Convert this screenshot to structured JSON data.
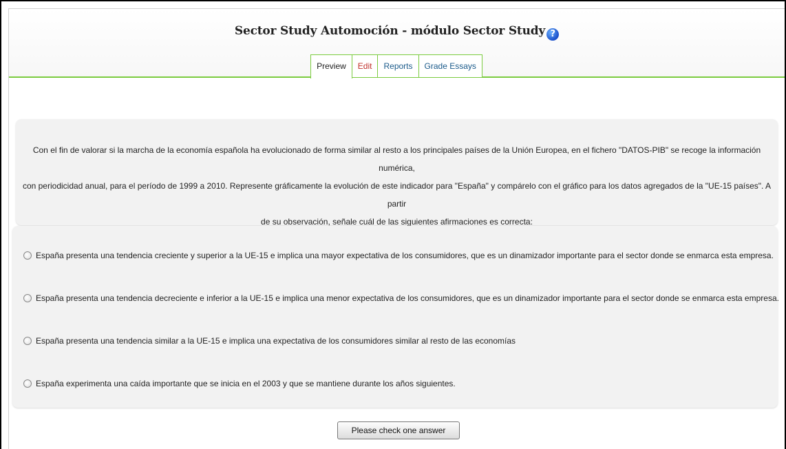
{
  "page": {
    "title": "Sector Study Automoción - módulo Sector Study",
    "help_icon": "?"
  },
  "tabs": [
    {
      "label": "Preview"
    },
    {
      "label": "Edit"
    },
    {
      "label": "Reports"
    },
    {
      "label": "Grade Essays"
    }
  ],
  "question": {
    "line1": "Con el fin de valorar si la marcha de la economía española ha evolucionado de forma similar al resto a los principales países de la Unión Europea, en el fichero \"DATOS-PIB\" se recoge la información numérica,",
    "line2": "con periodicidad anual, para el período de 1999 a 2010. Represente gráficamente la evolución de este indicador para \"España\" y compárelo con el gráfico para los datos agregados de la \"UE-15 países\". A partir",
    "line3": "de su observación, señale cuál de las siguientes afirmaciones es correcta:"
  },
  "answers": [
    {
      "text": "España presenta una tendencia creciente y superior a la UE-15 e implica una mayor expectativa de los consumidores, que es un dinamizador importante para el sector donde se enmarca esta empresa."
    },
    {
      "text": "España presenta una tendencia decreciente e inferior a la UE-15 e implica una menor expectativa de los consumidores, que es un dinamizador importante para el sector donde se enmarca esta empresa."
    },
    {
      "text": "España presenta una tendencia similar a la UE-15 e implica una expectativa de los consumidores similar al resto de las economías"
    },
    {
      "text": "España experimenta una caída importante que se inicia en el 2003 y que se mantiene durante los años siguientes."
    }
  ],
  "submit_label": "Please check one answer",
  "colors": {
    "accent": "#7acb3e",
    "edit_tab": "#c0302a",
    "link_tab": "#1a5a8a"
  }
}
